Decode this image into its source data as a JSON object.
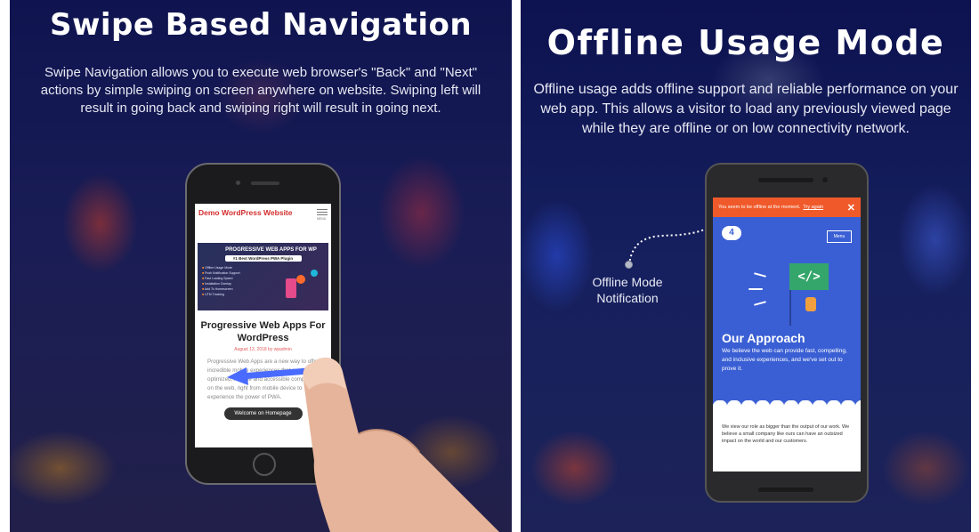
{
  "left_panel": {
    "title": "Swipe Based Navigation",
    "description": "Swipe Navigation allows you to execute web browser's  \"Back\" and  \"Next\" actions by simple swiping on screen anywhere on website. Swiping left will result in going back and swiping right will result in going next.",
    "phone": {
      "site_title": "Demo WordPress Website",
      "menu_label": "MENU",
      "banner_title": "PROGRESSIVE WEB APPS FOR WP",
      "banner_badge": "#1 Best WordPress PWA Plugin",
      "banner_features": [
        "Offline Usage Mode",
        "Push Notification Support",
        "Fast Loading Speed",
        "Installation Overlay",
        "Add To Homescreen",
        "UTM Tracking"
      ],
      "post_title": "Progressive Web Apps For WordPress",
      "post_meta": "August 13, 2018 by wpadmin",
      "post_excerpt": "Progressive Web Apps are a new way to offer incredible mobile experiences that are highly optimized, reliable and accessible completely on the web, right from mobile device to experience the power of PWA.",
      "button_label": "Welcome on Homepage"
    }
  },
  "right_panel": {
    "title": "Offline Usage Mode",
    "description": "Offline usage adds offline support and reliable performance on your web app. This allows a visitor to load any previously viewed page while they are offline or on low connectivity network.",
    "annotation": "Offline Mode Notification",
    "phone": {
      "offline_message": "You seem to be offline at the moment.",
      "try_again": "Try again",
      "close_symbol": "✕",
      "menu_label": "Menu",
      "code_symbol": "</>",
      "section_title": "Our Approach",
      "section_text": "We believe the web can provide fast, compelling, and inclusive experiences, and we've set out to prove it.",
      "footer_text": "We view our role as bigger than the output of our work. We believe a small company like ours can have an outsized impact on the world and our customers."
    }
  },
  "colors": {
    "background": "#151a55",
    "offline_bar": "#f05a2a",
    "app_blue": "#3a5fd4",
    "site_title_red": "#d42e2e",
    "swipe_arrow": "#4a6bff"
  }
}
